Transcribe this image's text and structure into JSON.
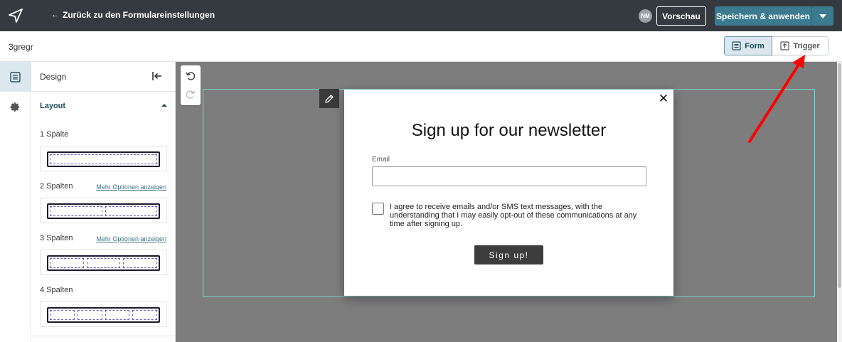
{
  "topbar": {
    "back_label": "Zurück zu den Formulareinstellungen",
    "back_arrow": "←",
    "avatar_initials": "NM",
    "preview_label": "Vorschau",
    "save_label": "Speichern & anwenden"
  },
  "subheader": {
    "form_name": "3gregr",
    "view_form_label": "Form",
    "view_trigger_label": "Trigger"
  },
  "panel": {
    "title": "Design",
    "section_title": "Layout",
    "layouts": [
      {
        "label": "1 Spalte",
        "more": ""
      },
      {
        "label": "2 Spalten",
        "more": "Mehr Optionen anzeigen"
      },
      {
        "label": "3 Spalten",
        "more": "Mehr Optionen anzeigen"
      },
      {
        "label": "4 Spalten",
        "more": ""
      }
    ]
  },
  "popup": {
    "title": "Sign up for our newsletter",
    "email_label": "Email",
    "email_value": "",
    "consent_text": "I agree to receive emails and/or SMS text messages, with the understanding that I may easily opt-out of these communications at any time after signing up.",
    "signup_label": "Sign up!",
    "close_symbol": "✕"
  },
  "colors": {
    "topbar_bg": "#353a40",
    "accent": "#3b7a8f",
    "canvas_bg": "#7d7d7d",
    "selection_border": "#7fd3c8",
    "annotation_arrow": "#ff0000"
  },
  "icons": {
    "logo": "paper-plane-icon",
    "save_dropdown": "caret-down-icon",
    "form_view": "form-icon",
    "trigger_view": "trigger-icon",
    "rail_design": "design-icon",
    "rail_settings": "gear-icon",
    "collapse": "collapse-panel-icon",
    "undo": "undo-icon",
    "redo": "redo-icon",
    "edit": "pencil-icon"
  }
}
